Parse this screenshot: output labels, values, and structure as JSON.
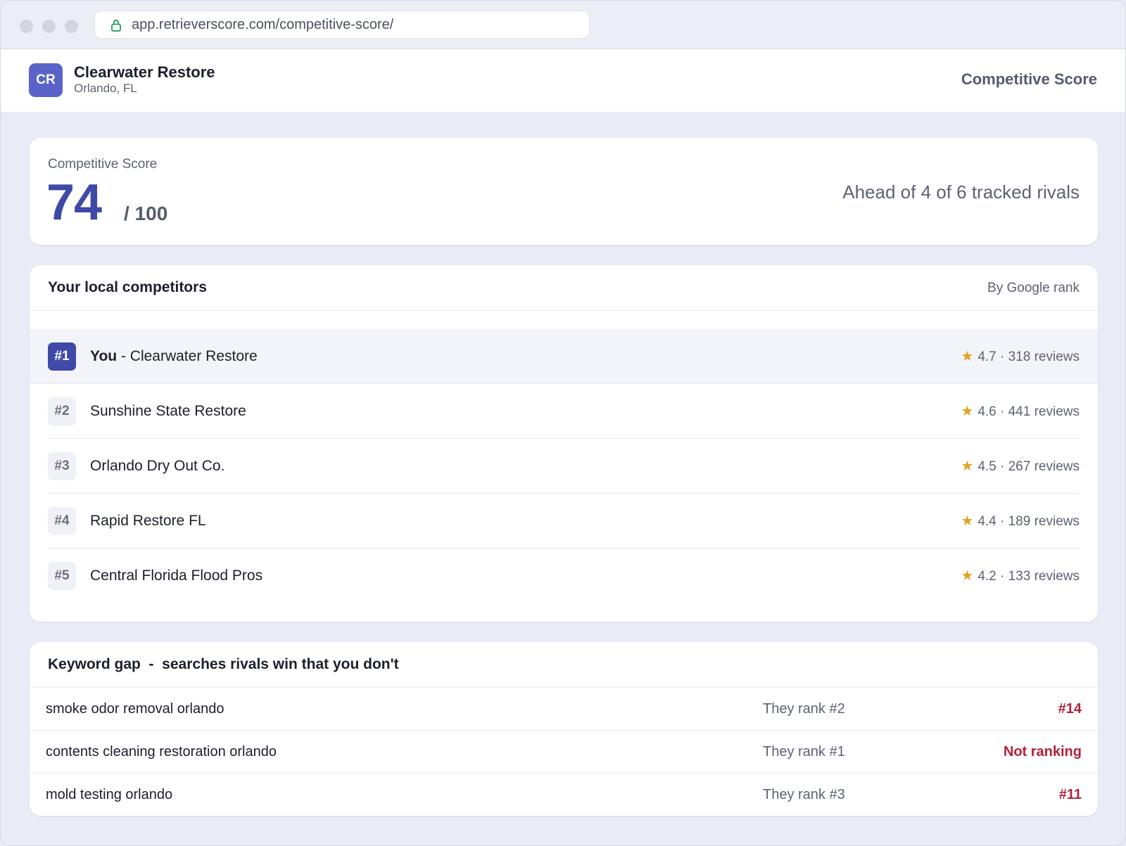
{
  "browser": {
    "url": "app.retrieverscore.com/competitive-score/"
  },
  "header": {
    "logo_initials": "CR",
    "business_name": "Clearwater Restore",
    "location": "Orlando, FL",
    "page_label": "Competitive Score"
  },
  "score": {
    "label": "Competitive Score",
    "value": "74",
    "max": "/ 100",
    "summary": "Ahead of 4 of 6 tracked rivals"
  },
  "competitors": {
    "title": "Your local competitors",
    "sort_label": "By Google rank",
    "you_label": "You",
    "separator": " - ",
    "star": "★",
    "items": [
      {
        "rank": "#1",
        "name": "Clearwater Restore",
        "rating": "4.7 · 318 reviews"
      },
      {
        "rank": "#2",
        "name": "Sunshine State Restore",
        "rating": "4.6 · 441 reviews"
      },
      {
        "rank": "#3",
        "name": "Orlando Dry Out Co.",
        "rating": "4.5 · 267 reviews"
      },
      {
        "rank": "#4",
        "name": "Rapid Restore FL",
        "rating": "4.4 · 189 reviews"
      },
      {
        "rank": "#5",
        "name": "Central Florida Flood Pros",
        "rating": "4.2 · 133 reviews"
      }
    ]
  },
  "keyword_gap": {
    "title": "Keyword gap  -  searches rivals win that you don't",
    "rows": [
      {
        "term": "smoke odor removal orlando",
        "rival_rank": "They rank #2",
        "your_rank": "#14"
      },
      {
        "term": "contents cleaning restoration orlando",
        "rival_rank": "They rank #1",
        "your_rank": "Not ranking"
      },
      {
        "term": "mold testing orlando",
        "rival_rank": "They rank #3",
        "your_rank": "#11"
      }
    ]
  },
  "colors": {
    "accent": "#3f4aa8",
    "logo": "#5b63c9",
    "star": "#e0a321",
    "alert": "#b3223b",
    "page_bg": "#e9ecf6"
  }
}
